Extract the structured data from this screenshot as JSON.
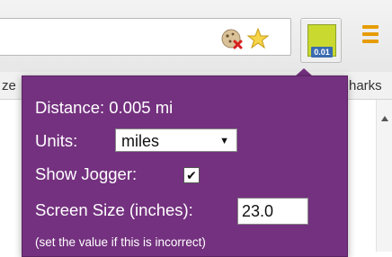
{
  "browser": {
    "bookmarks_left_fragment": "ze",
    "bookmarks_right_fragment": "harks",
    "extension_badge": "0.01",
    "icons": [
      "cookie-blocked-icon",
      "star-icon",
      "extension-icon",
      "menu-icon",
      "scroll-up-icon"
    ]
  },
  "popup": {
    "distance_text": "Distance: 0.005 mi",
    "units_label": "Units:",
    "units_value": "miles",
    "show_jogger_label": "Show Jogger:",
    "show_jogger_checked": true,
    "screen_size_label": "Screen Size (inches):",
    "screen_size_value": "23.0",
    "hint": "(set the value if this is incorrect)",
    "background_color": "#74317f"
  }
}
